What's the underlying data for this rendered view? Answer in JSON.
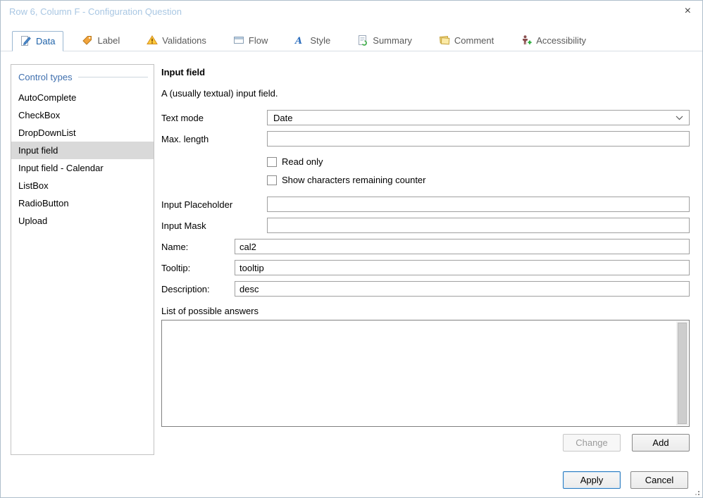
{
  "dialog": {
    "title": "Row 6, Column F - Configuration Question",
    "close_glyph": "×"
  },
  "tabs": [
    {
      "label": "Data",
      "icon": "edit-icon",
      "active": true
    },
    {
      "label": "Label",
      "icon": "tag-icon",
      "active": false
    },
    {
      "label": "Validations",
      "icon": "warning-icon",
      "active": false
    },
    {
      "label": "Flow",
      "icon": "window-icon",
      "active": false
    },
    {
      "label": "Style",
      "icon": "font-icon",
      "active": false
    },
    {
      "label": "Summary",
      "icon": "summary-page-icon",
      "active": false
    },
    {
      "label": "Comment",
      "icon": "comment-notes-icon",
      "active": false
    },
    {
      "label": "Accessibility",
      "icon": "accessibility-person-icon",
      "active": false
    }
  ],
  "sidebar": {
    "header": "Control types",
    "items": [
      {
        "label": "AutoComplete",
        "selected": false
      },
      {
        "label": "CheckBox",
        "selected": false
      },
      {
        "label": "DropDownList",
        "selected": false
      },
      {
        "label": "Input field",
        "selected": true
      },
      {
        "label": "Input field - Calendar",
        "selected": false
      },
      {
        "label": "ListBox",
        "selected": false
      },
      {
        "label": "RadioButton",
        "selected": false
      },
      {
        "label": "Upload",
        "selected": false
      }
    ]
  },
  "content": {
    "heading": "Input field",
    "description": "A (usually textual) input field.",
    "fields": {
      "text_mode": {
        "label": "Text mode",
        "value": "Date"
      },
      "max_length": {
        "label": "Max. length",
        "value": ""
      },
      "read_only": {
        "label": "Read only",
        "checked": false
      },
      "show_counter": {
        "label": "Show characters remaining counter",
        "checked": false
      },
      "input_placeholder": {
        "label": "Input Placeholder",
        "value": ""
      },
      "input_mask": {
        "label": "Input Mask",
        "value": ""
      },
      "name": {
        "label": "Name:",
        "value": "cal2"
      },
      "tooltip": {
        "label": "Tooltip:",
        "value": "tooltip"
      },
      "description": {
        "label": "Description:",
        "value": "desc"
      }
    },
    "answers": {
      "label": "List of possible answers",
      "items": []
    },
    "buttons": {
      "change": "Change",
      "change_enabled": false,
      "add": "Add"
    }
  },
  "footer": {
    "apply": "Apply",
    "cancel": "Cancel"
  },
  "colors": {
    "title_text": "#a9c7e3",
    "active_tab_text": "#1e62a9",
    "sidebar_header_text": "#3f6fae",
    "selected_item_bg": "#d9d9d9",
    "apply_button_border": "#2a7bc0",
    "tag_icon_orange": "#f2a43c",
    "warning_icon_yellow": "#fdca3c",
    "accessibility_plus_green": "#2fae3f"
  }
}
